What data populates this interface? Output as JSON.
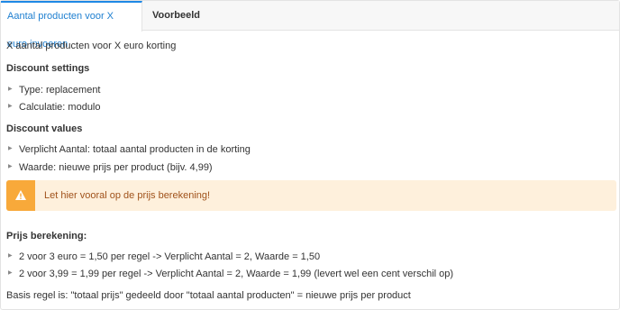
{
  "tabs": [
    {
      "label": "Aantal producten voor X euro invoeren"
    },
    {
      "label": "Voorbeeld"
    }
  ],
  "content": {
    "intro": "X aantal producten voor X euro korting",
    "discount_settings": {
      "heading": "Discount settings",
      "items": [
        "Type: replacement",
        "Calculatie: modulo"
      ]
    },
    "discount_values": {
      "heading": "Discount values",
      "items": [
        "Verplicht Aantal: totaal aantal producten in de korting",
        "Waarde: nieuwe prijs per product (bijv. 4,99)"
      ]
    },
    "alert": {
      "icon": "warning-icon",
      "text": "Let hier vooral op de prijs berekening!",
      "colors": {
        "bg": "#fef0dc",
        "icon_bg": "#f8a93a",
        "text": "#a0521b"
      }
    },
    "price_calc": {
      "heading": "Prijs berekening:",
      "items": [
        "2 voor 3 euro = 1,50 per regel -> Verplicht Aantal = 2, Waarde = 1,50",
        "2 voor 3,99 = 1,99 per regel -> Verplicht Aantal = 2, Waarde = 1,99 (levert wel een cent verschil op)"
      ]
    },
    "footer": "Basis regel is: \"totaal prijs\" gedeeld door \"totaal aantal producten\" = nieuwe prijs per product"
  }
}
